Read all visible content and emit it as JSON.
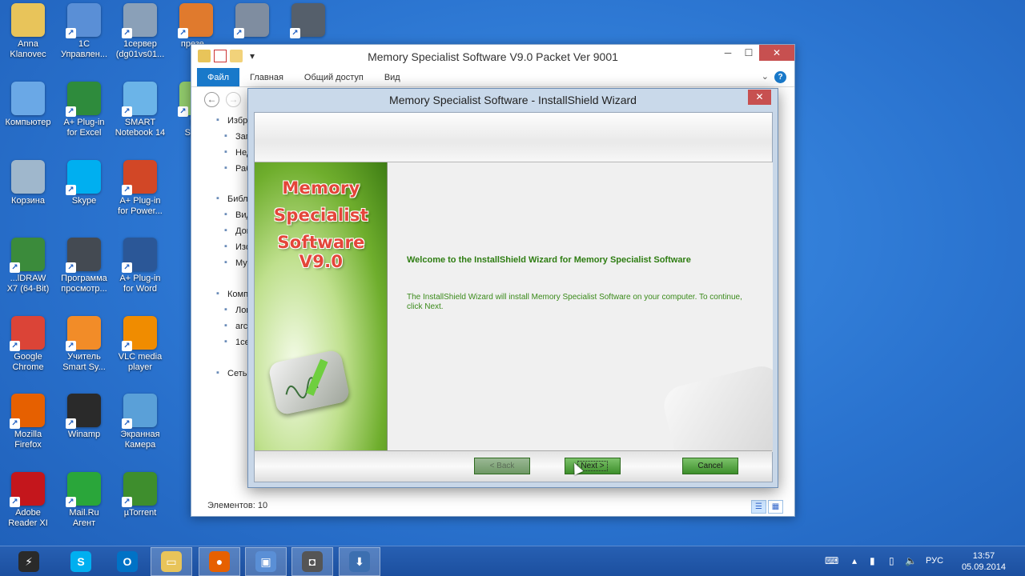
{
  "desktop_icons": [
    {
      "label": "Anna\nKlanovec",
      "icon": "user-folder-icon",
      "color": "#e8c45a"
    },
    {
      "label": "1С\nУправлен...",
      "icon": "remote-desktop-icon",
      "color": "#5a8fd6"
    },
    {
      "label": "1сервер\n(dg01vs01...",
      "icon": "server-drive-icon",
      "color": "#8aa0b8"
    },
    {
      "label": "презе...",
      "icon": "presentation-icon",
      "color": "#e07a2d"
    },
    {
      "label": "",
      "icon": "users-icon",
      "color": "#7f8da0"
    },
    {
      "label": "",
      "icon": "user-key-icon",
      "color": "#555f6b"
    },
    {
      "label": "Компьютер",
      "icon": "computer-icon",
      "color": "#6aa8e6"
    },
    {
      "label": "A+ Plug-in\nfor Excel",
      "icon": "excel-plugin-icon",
      "color": "#2e8b3c"
    },
    {
      "label": "SMART\nNotebook 14",
      "icon": "smart-notebook-icon",
      "color": "#6bb4e8"
    },
    {
      "label": "Me\nSpe...",
      "icon": "memory-specialist-icon",
      "color": "#8ec66a"
    },
    {
      "label": "Корзина",
      "icon": "recycle-bin-icon",
      "color": "#9fb7cc"
    },
    {
      "label": "Skype",
      "icon": "skype-icon",
      "color": "#00aff0"
    },
    {
      "label": "A+ Plug-in\nfor Power...",
      "icon": "powerpoint-plugin-icon",
      "color": "#d24726"
    },
    {
      "label": "...lDRAW\nX7 (64-Bit)",
      "icon": "coreldraw-icon",
      "color": "#3b8b3b"
    },
    {
      "label": "Программа\nпросмотр...",
      "icon": "viewer-program-icon",
      "color": "#444a52"
    },
    {
      "label": "A+ Plug-in\nfor Word",
      "icon": "word-plugin-icon",
      "color": "#2b5797"
    },
    {
      "label": "Google\nChrome",
      "icon": "chrome-icon",
      "color": "#db4437"
    },
    {
      "label": "Учитель\nSmart Sy...",
      "icon": "smart-teacher-icon",
      "color": "#f28c28"
    },
    {
      "label": "VLC media\nplayer",
      "icon": "vlc-icon",
      "color": "#f08c00"
    },
    {
      "label": "Mozilla\nFirefox",
      "icon": "firefox-icon",
      "color": "#e66000"
    },
    {
      "label": "Winamp",
      "icon": "winamp-icon",
      "color": "#2a2a2a"
    },
    {
      "label": "Экранная\nКамера",
      "icon": "screen-camera-icon",
      "color": "#5aa0d8"
    },
    {
      "label": "Adobe\nReader XI",
      "icon": "adobe-reader-icon",
      "color": "#c4161c"
    },
    {
      "label": "Mail.Ru\nАгент",
      "icon": "mailru-agent-icon",
      "color": "#2aa63a"
    },
    {
      "label": "µTorrent",
      "icon": "utorrent-icon",
      "color": "#3e8e2d"
    }
  ],
  "explorer": {
    "title": "Memory Specialist Software V9.0 Packet Ver 9001",
    "tabs": [
      "Файл",
      "Главная",
      "Общий доступ",
      "Вид"
    ],
    "nav": [
      {
        "label": "Избр",
        "icon": "star-icon"
      },
      {
        "label": "Заг",
        "icon": "downloads-icon"
      },
      {
        "label": "Нед",
        "icon": "recent-places-icon"
      },
      {
        "label": "Раб",
        "icon": "desktop-folder-icon"
      },
      {
        "label": "Библ",
        "icon": "libraries-icon"
      },
      {
        "label": "Вид",
        "icon": "videos-icon"
      },
      {
        "label": "Док",
        "icon": "documents-icon"
      },
      {
        "label": "Изо",
        "icon": "pictures-icon"
      },
      {
        "label": "Му",
        "icon": "music-icon"
      },
      {
        "label": "Комп",
        "icon": "computer-icon"
      },
      {
        "label": "Лок",
        "icon": "local-disk-icon"
      },
      {
        "label": "arc",
        "icon": "drive-icon"
      },
      {
        "label": "1се",
        "icon": "network-drive-icon"
      },
      {
        "label": "Сеть",
        "icon": "network-icon"
      }
    ],
    "status": "Элементов: 10"
  },
  "wizard": {
    "title": "Memory Specialist Software - InstallShield Wizard",
    "brand_lines": [
      "Memory",
      "Specialist",
      "Software V9.0"
    ],
    "welcome": "Welcome to the InstallShield Wizard for Memory Specialist Software",
    "description": "The InstallShield Wizard will install Memory Specialist Software on your computer.  To continue, click Next.",
    "buttons": {
      "back": "< Back",
      "next": "Next >",
      "cancel": "Cancel"
    },
    "accent": "#3d8f2b"
  },
  "taskbar": {
    "items": [
      {
        "icon": "winamp-icon",
        "color": "#2a2a2a",
        "glyph": "⚡"
      },
      {
        "icon": "skype-icon",
        "color": "#00aff0",
        "glyph": "S"
      },
      {
        "icon": "outlook-icon",
        "color": "#0072c6",
        "glyph": "O"
      },
      {
        "icon": "file-explorer-icon",
        "color": "#e8c45a",
        "glyph": "▭"
      },
      {
        "icon": "firefox-icon",
        "color": "#e66000",
        "glyph": "●"
      },
      {
        "icon": "remote-desktop-icon",
        "color": "#5a8fd6",
        "glyph": "▣"
      },
      {
        "icon": "screen-camera-icon",
        "color": "#555",
        "glyph": "◘"
      },
      {
        "icon": "installer-icon",
        "color": "#3c6fb0",
        "glyph": "⬇"
      }
    ],
    "lang": "РУС",
    "time": "13:57",
    "date": "05.09.2014"
  }
}
